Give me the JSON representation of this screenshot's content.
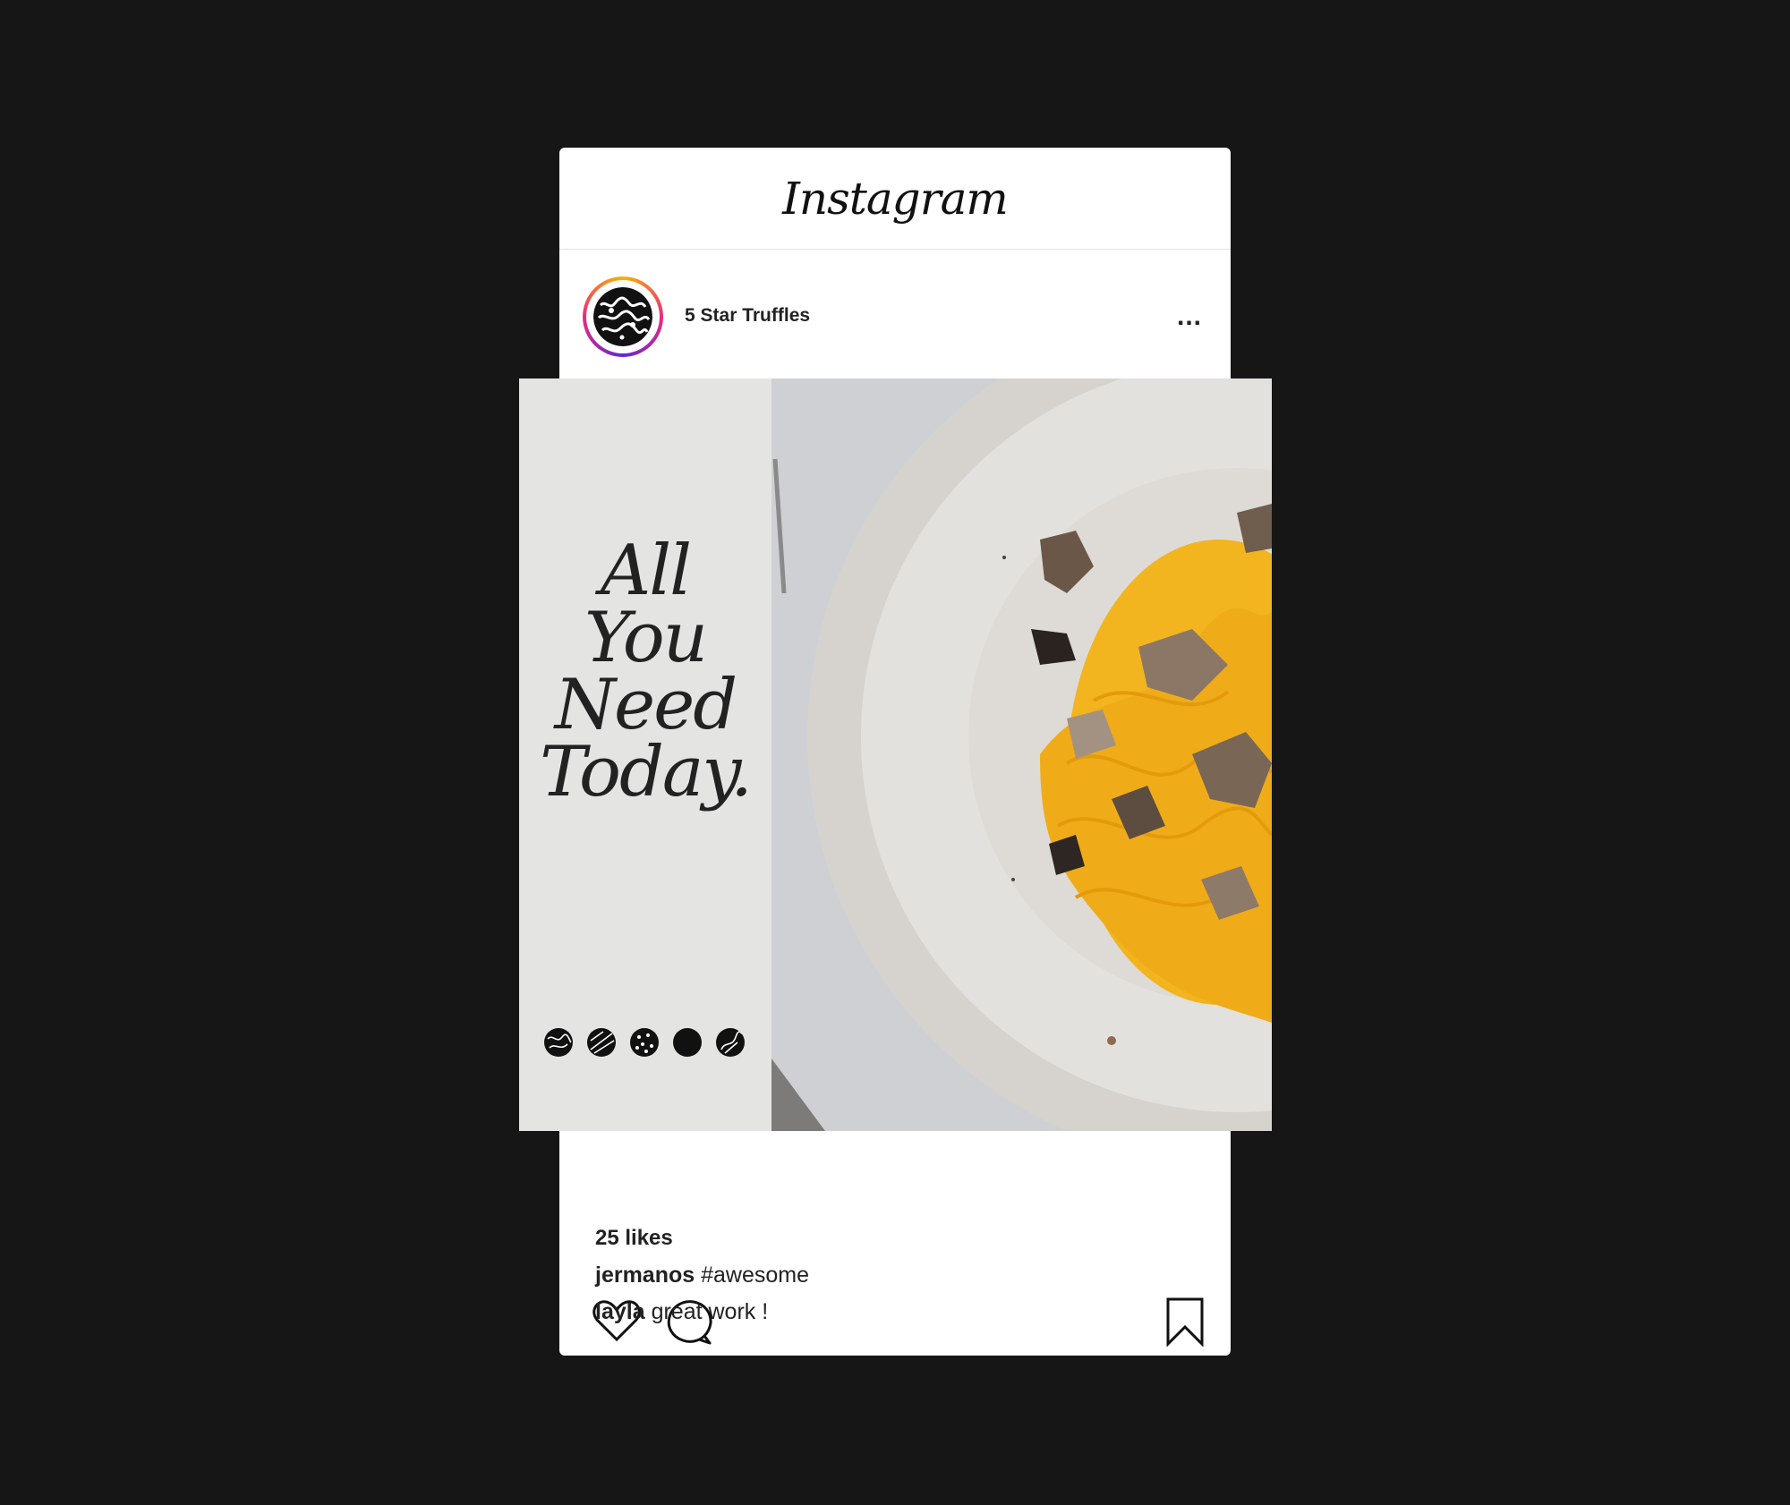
{
  "app": {
    "brand": "Instagram"
  },
  "post": {
    "account": "5 Star Truffles",
    "more_label": "...",
    "headline": [
      "All",
      "You",
      "Need",
      "Today."
    ]
  },
  "engagement": {
    "likes": "25 likes"
  },
  "comments": [
    {
      "user": "jermanos",
      "text": "#awesome"
    },
    {
      "user": "layla",
      "text": "great work !"
    }
  ],
  "colors": {
    "background": "#161616",
    "card": "#ffffff",
    "panel": "#e4e4e2",
    "pasta": "#f2b51f"
  }
}
